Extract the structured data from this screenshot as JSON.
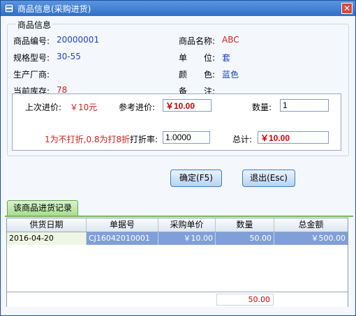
{
  "window": {
    "title": "商品信息(采购进货)"
  },
  "group": {
    "title": "商品信息"
  },
  "info": {
    "code_label": "商品编号:",
    "code_value": "20000001",
    "name_label": "商品名称:",
    "name_value": "ABC",
    "spec_label": "规格型号:",
    "spec_value": "30-55",
    "unit_label": "单　　位:",
    "unit_value": "套",
    "maker_label": "生产厂商:",
    "maker_value": "",
    "color_label": "颜　　色:",
    "color_value": "蓝色",
    "stock_label": "当前库存:",
    "stock_value": "78",
    "note_label": "备　　注:",
    "note_value": ""
  },
  "pricing": {
    "last_price_label": "上次进价:",
    "last_price_value": "￥10元",
    "ref_price_label": "参考进价:",
    "ref_price_value": "￥10.00",
    "qty_label": "数量:",
    "qty_value": "1",
    "discount_hint": "1为不打折,0.8为打8折",
    "discount_label": "打折率:",
    "discount_value": "1.0000",
    "total_label": "总计:",
    "total_value": "￥10.00"
  },
  "buttons": {
    "ok": "确定(F5)",
    "exit": "退出(Esc)"
  },
  "tab": {
    "label": "该商品进货记录"
  },
  "table": {
    "headers": [
      "供货日期",
      "单据号",
      "采购单价",
      "数量",
      "总金额"
    ],
    "rows": [
      [
        "2016-04-20",
        "CJ16042010001",
        "￥10.00",
        "50.00",
        "￥500.00"
      ]
    ],
    "footer_qty_sum": "50.00"
  },
  "colors": {
    "titlebar": "#2f6fc7",
    "selected_row": "#7f9fd9",
    "value_blue": "#2040c0",
    "value_red": "#d02020"
  }
}
